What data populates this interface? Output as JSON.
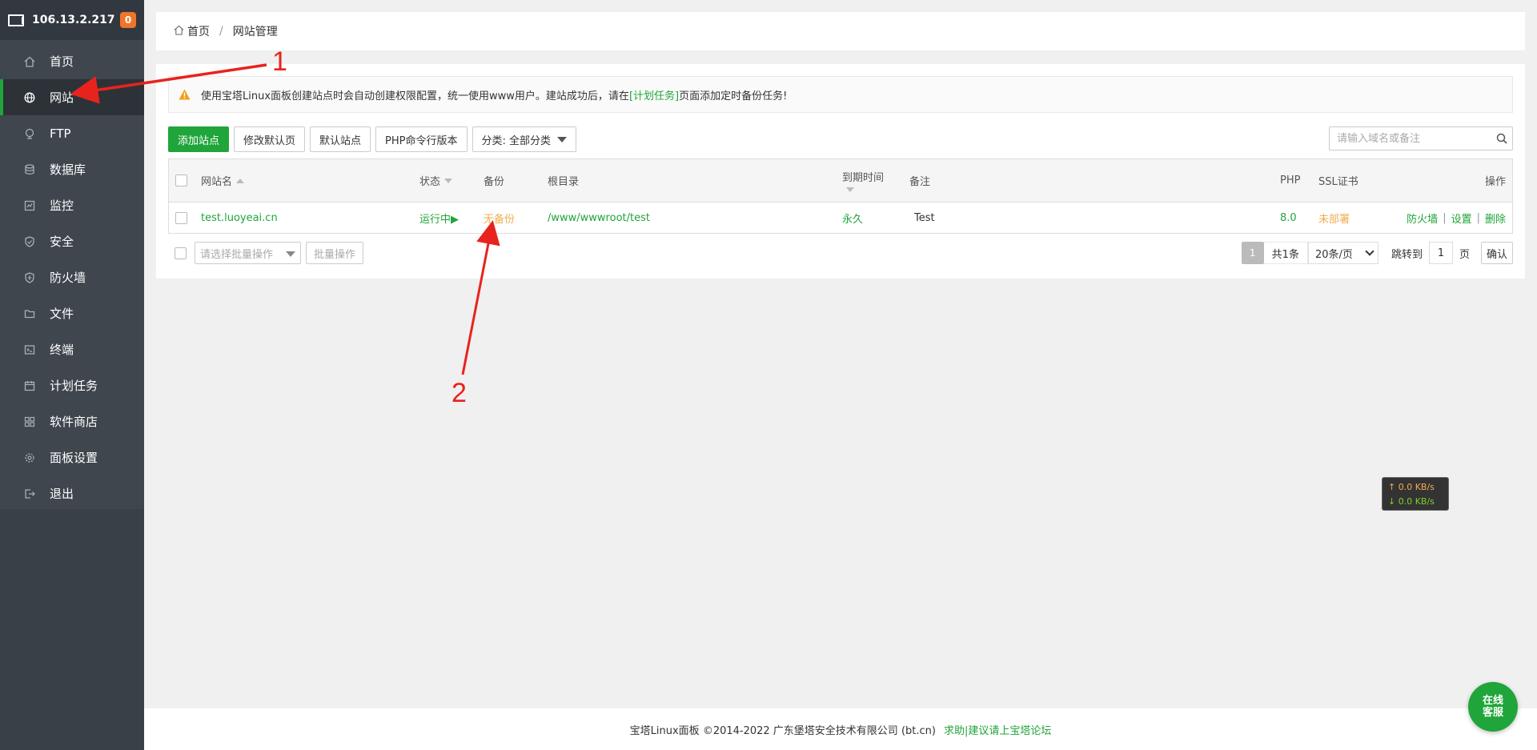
{
  "sidebar": {
    "server_ip": "106.13.2.217",
    "notification_count": "0",
    "items": [
      {
        "label": "首页",
        "icon": "home-icon"
      },
      {
        "label": "网站",
        "icon": "globe-icon"
      },
      {
        "label": "FTP",
        "icon": "ftp-icon"
      },
      {
        "label": "数据库",
        "icon": "database-icon"
      },
      {
        "label": "监控",
        "icon": "monitor-icon"
      },
      {
        "label": "安全",
        "icon": "shield-icon"
      },
      {
        "label": "防火墙",
        "icon": "firewall-icon"
      },
      {
        "label": "文件",
        "icon": "folder-icon"
      },
      {
        "label": "终端",
        "icon": "terminal-icon"
      },
      {
        "label": "计划任务",
        "icon": "calendar-icon"
      },
      {
        "label": "软件商店",
        "icon": "grid-icon"
      },
      {
        "label": "面板设置",
        "icon": "gear-icon"
      },
      {
        "label": "退出",
        "icon": "logout-icon"
      }
    ]
  },
  "breadcrumb": {
    "home": "首页",
    "separator": "/",
    "current": "网站管理"
  },
  "notice": {
    "text_before": "使用宝塔Linux面板创建站点时会自动创建权限配置，统一使用www用户。建站成功后，请在",
    "link": "[计划任务]",
    "text_after": "页面添加定时备份任务!"
  },
  "toolbar": {
    "add_site": "添加站点",
    "edit_default_page": "修改默认页",
    "default_site": "默认站点",
    "php_cli_version": "PHP命令行版本",
    "category": "分类: 全部分类"
  },
  "search": {
    "placeholder": "请输入域名或备注"
  },
  "table": {
    "headers": {
      "name": "网站名",
      "status": "状态",
      "backup": "备份",
      "root": "根目录",
      "expire": "到期时间",
      "remark": "备注",
      "php": "PHP",
      "ssl": "SSL证书",
      "actions": "操作"
    },
    "rows": [
      {
        "name": "test.luoyeai.cn",
        "status": "运行中▶",
        "backup": "无备份",
        "root": "/www/wwwroot/test",
        "expire": "永久",
        "remark": "Test",
        "php": "8.0",
        "ssl": "未部署",
        "actions": [
          "防火墙",
          "设置",
          "删除"
        ],
        "action_separator": "|"
      }
    ]
  },
  "bottombar": {
    "batch_placeholder": "请选择批量操作",
    "batch_button": "批量操作"
  },
  "pager": {
    "current_page": "1",
    "total": "共1条",
    "page_size": "20条/页",
    "jump_label": "跳转到",
    "jump_value": "1",
    "page_unit": "页",
    "confirm": "确认"
  },
  "footer": {
    "copyright": "宝塔Linux面板 ©2014-2022 广东堡塔安全技术有限公司 (bt.cn)",
    "forum_link": "求助|建议请上宝塔论坛"
  },
  "netspeed": {
    "up": "↑ 0.0 KB/s",
    "down": "↓ 0.0 KB/s"
  },
  "service": {
    "line1": "在线",
    "line2": "客服"
  },
  "annotations": {
    "label1": "1",
    "label2": "2"
  },
  "colors": {
    "accent": "#20a53a",
    "warning": "#f0ad4e",
    "sidebar_bg": "#3a4047",
    "annotation": "#e8231d"
  }
}
